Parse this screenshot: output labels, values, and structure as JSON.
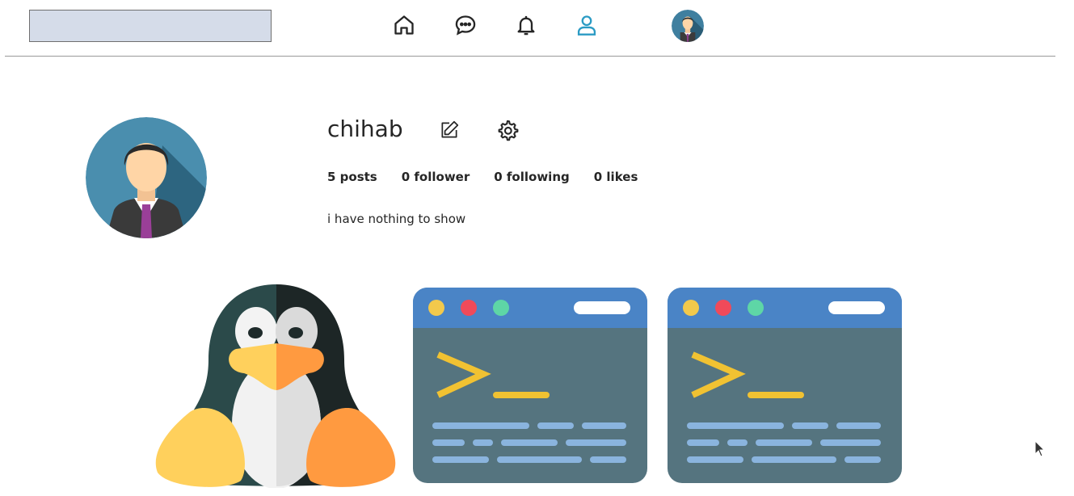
{
  "header": {
    "search": {
      "value": "",
      "placeholder": ""
    },
    "nav": [
      {
        "icon": "home-icon"
      },
      {
        "icon": "messages-icon"
      },
      {
        "icon": "notifications-icon"
      },
      {
        "icon": "profile-icon",
        "active": true,
        "active_color": "#2b9bc4"
      }
    ]
  },
  "profile": {
    "username": "chihab",
    "stats": {
      "posts": "5 posts",
      "followers": "0 follower",
      "following": "0 following",
      "likes": "0 likes"
    },
    "bio": "i have nothing to show"
  },
  "posts": [
    {
      "icon": "linux-penguin-icon"
    },
    {
      "icon": "terminal-window-icon"
    },
    {
      "icon": "terminal-window-icon"
    }
  ],
  "colors": {
    "search_bg": "#d5dce9",
    "accent": "#2b9bc4",
    "terminal_header": "#4a84c6",
    "terminal_body": "#55747f"
  }
}
